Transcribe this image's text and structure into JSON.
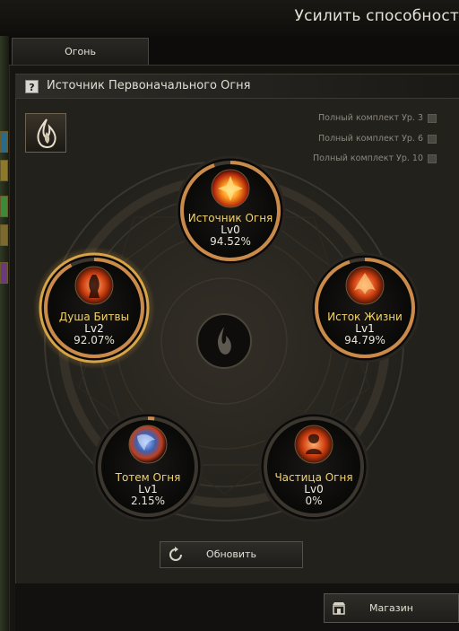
{
  "window": {
    "title": "Усилить способност"
  },
  "tabs": [
    {
      "label": "Огонь",
      "active": true
    }
  ],
  "section": {
    "help_glyph": "?",
    "title": "Источник Первоначального Огня"
  },
  "element_icon": "fire-flame-icon",
  "set_bonuses": [
    {
      "label": "Полный комплект Ур. 3",
      "checked": false
    },
    {
      "label": "Полный комплект Ур. 6",
      "checked": false
    },
    {
      "label": "Полный комплект Ур. 10",
      "checked": false
    }
  ],
  "nodes": [
    {
      "name": "Источник Огня",
      "level": "Lv0",
      "percent": "94.52%",
      "progress": 0.9452,
      "highlighted": false,
      "icon": "fire-burst-icon"
    },
    {
      "name": "Душа Битвы",
      "level": "Lv2",
      "percent": "92.07%",
      "progress": 0.9207,
      "highlighted": true,
      "icon": "fire-mage-icon"
    },
    {
      "name": "Исток Жизни",
      "level": "Lv1",
      "percent": "94.79%",
      "progress": 0.9479,
      "highlighted": false,
      "icon": "fire-hands-icon"
    },
    {
      "name": "Тотем Огня",
      "level": "Lv1",
      "percent": "2.15%",
      "progress": 0.0215,
      "highlighted": false,
      "icon": "fire-totem-icon"
    },
    {
      "name": "Частица Огня",
      "level": "Lv0",
      "percent": "0%",
      "progress": 0.0,
      "highlighted": false,
      "icon": "fire-warrior-icon"
    }
  ],
  "center_icon": "flame-emblem-icon",
  "buttons": {
    "refresh": "Обновить",
    "shop": "Магазин"
  },
  "colors": {
    "gold_name": "#f1d36a",
    "ring_bronze": "#c98a4a",
    "highlight": "#f0b040"
  }
}
